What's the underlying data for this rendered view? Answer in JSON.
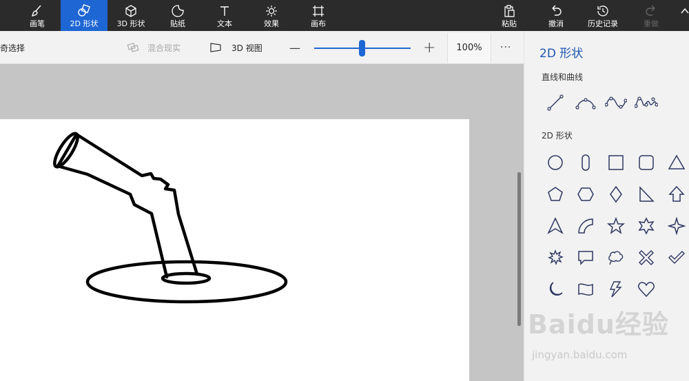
{
  "ribbon": {
    "items": [
      {
        "label": "画笔",
        "icon": "brush-icon"
      },
      {
        "label": "2D 形状",
        "icon": "2d-shapes-icon"
      },
      {
        "label": "3D 形状",
        "icon": "3d-cube-icon"
      },
      {
        "label": "贴纸",
        "icon": "sticker-icon"
      },
      {
        "label": "文本",
        "icon": "text-icon"
      },
      {
        "label": "效果",
        "icon": "effects-sun-icon"
      },
      {
        "label": "画布",
        "icon": "canvas-crop-icon"
      }
    ],
    "right_items": [
      {
        "label": "粘贴",
        "icon": "paste-icon"
      },
      {
        "label": "撤消",
        "icon": "undo-icon"
      },
      {
        "label": "历史记录",
        "icon": "history-icon"
      },
      {
        "label": "重做",
        "icon": "redo-icon"
      }
    ],
    "active_index": 1,
    "accent": "#1e66d4"
  },
  "toolbar": {
    "select_label": "奇选择",
    "mixed_reality_label": "混合现实",
    "view3d_label": "3D 视图",
    "zoom_minus": "—",
    "zoom_plus": "+",
    "zoom_percent": 100,
    "zoom_value": "100%",
    "more": "···"
  },
  "panel": {
    "title": "2D 形状",
    "lines_section": "直线和曲线",
    "shapes_section": "2D 形状",
    "line_tools": [
      "line-icon",
      "curve-icon",
      "two-point-curve-icon",
      "three-point-curve-icon"
    ],
    "shapes": [
      "circle-icon",
      "rounded-pill-icon",
      "square-icon",
      "rounded-square-icon",
      "triangle-icon",
      "pentagon-icon",
      "hexagon-icon",
      "diamond-icon",
      "right-triangle-icon",
      "arrow-up-icon",
      "arrow-pointer-icon",
      "quarter-ring-icon",
      "star5-icon",
      "star6-icon",
      "star4-icon",
      "burst-icon",
      "speech-bubble-icon",
      "thought-bubble-icon",
      "cross-icon",
      "checkmark-icon",
      "crescent-moon-icon",
      "wave-flag-icon",
      "lightning-icon",
      "heart-icon"
    ]
  },
  "watermark": {
    "main": "Baidu经验",
    "sub": "jingyan.baidu.com"
  }
}
